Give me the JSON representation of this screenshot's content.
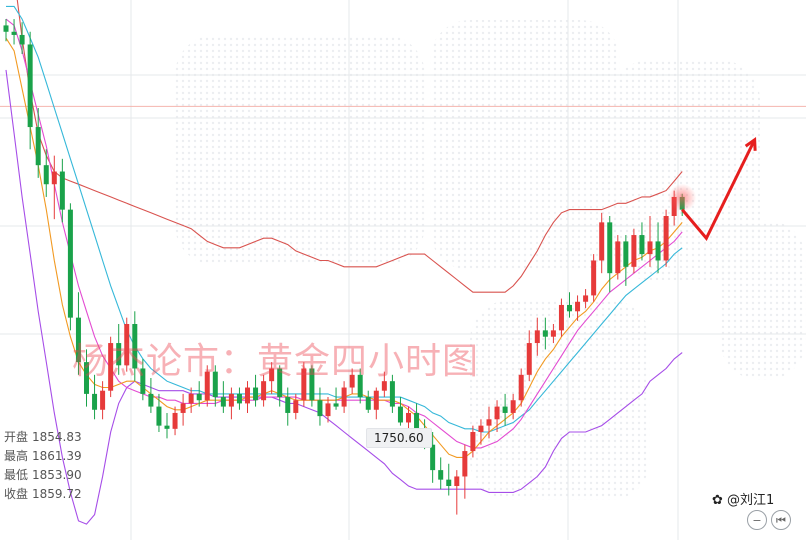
{
  "ohlc": {
    "open_label": "开盘",
    "open_value": "1854.83",
    "high_label": "最高",
    "high_value": "1861.39",
    "low_label": "最低",
    "low_value": "1853.90",
    "close_label": "收盘",
    "close_value": "1859.72"
  },
  "low_marker": "1750.60",
  "watermark": "杨杰论市：黄金四小时图",
  "author": "刘江1",
  "controls": {
    "zoom_out": "−",
    "reset": "⏮"
  },
  "colors": {
    "up": "#e63a3a",
    "down": "#1aa24a",
    "bollinger_upper": "#d9534f",
    "bollinger_lower": "#a64de8",
    "ma_orange": "#f29a22",
    "ma_magenta": "#e34bd2",
    "ma_cyan": "#36b8d9",
    "forecast": "#e61e1e",
    "price_line": "#f4b4ae"
  },
  "chart_data": {
    "type": "candlestick",
    "instrument": "XAU 4H",
    "y_range": [
      1722,
      1892
    ],
    "marked_low": 1750.6,
    "candles": [
      [
        1884,
        1886,
        1879,
        1882
      ],
      [
        1882,
        1886,
        1878,
        1881
      ],
      [
        1881,
        1885,
        1875,
        1878
      ],
      [
        1878,
        1882,
        1845,
        1852
      ],
      [
        1852,
        1858,
        1836,
        1840
      ],
      [
        1840,
        1845,
        1830,
        1834
      ],
      [
        1834,
        1843,
        1823,
        1838
      ],
      [
        1838,
        1842,
        1822,
        1826
      ],
      [
        1826,
        1828,
        1788,
        1792
      ],
      [
        1792,
        1800,
        1774,
        1778
      ],
      [
        1778,
        1782,
        1764,
        1768
      ],
      [
        1768,
        1774,
        1760,
        1763
      ],
      [
        1763,
        1772,
        1760,
        1769
      ],
      [
        1769,
        1786,
        1767,
        1784
      ],
      [
        1784,
        1790,
        1774,
        1777
      ],
      [
        1777,
        1792,
        1775,
        1790
      ],
      [
        1790,
        1794,
        1772,
        1776
      ],
      [
        1776,
        1779,
        1766,
        1768
      ],
      [
        1768,
        1773,
        1762,
        1764
      ],
      [
        1764,
        1768,
        1756,
        1758
      ],
      [
        1758,
        1762,
        1754,
        1757
      ],
      [
        1757,
        1764,
        1755,
        1762
      ],
      [
        1762,
        1768,
        1758,
        1765
      ],
      [
        1765,
        1770,
        1762,
        1768
      ],
      [
        1768,
        1772,
        1764,
        1766
      ],
      [
        1766,
        1777,
        1764,
        1775
      ],
      [
        1775,
        1777,
        1764,
        1767
      ],
      [
        1767,
        1772,
        1762,
        1764
      ],
      [
        1764,
        1770,
        1760,
        1768
      ],
      [
        1768,
        1770,
        1763,
        1765
      ],
      [
        1765,
        1772,
        1762,
        1770
      ],
      [
        1770,
        1774,
        1764,
        1766
      ],
      [
        1766,
        1774,
        1764,
        1772
      ],
      [
        1772,
        1778,
        1768,
        1776
      ],
      [
        1776,
        1777,
        1764,
        1767
      ],
      [
        1767,
        1770,
        1758,
        1762
      ],
      [
        1762,
        1768,
        1760,
        1766
      ],
      [
        1766,
        1778,
        1764,
        1776
      ],
      [
        1776,
        1777,
        1764,
        1766
      ],
      [
        1766,
        1770,
        1758,
        1761
      ],
      [
        1761,
        1767,
        1759,
        1765
      ],
      [
        1765,
        1770,
        1763,
        1764
      ],
      [
        1764,
        1772,
        1762,
        1770
      ],
      [
        1770,
        1776,
        1768,
        1774
      ],
      [
        1774,
        1776,
        1765,
        1767
      ],
      [
        1767,
        1769,
        1762,
        1763
      ],
      [
        1763,
        1770,
        1760,
        1769
      ],
      [
        1769,
        1775,
        1767,
        1772
      ],
      [
        1772,
        1774,
        1762,
        1764
      ],
      [
        1764,
        1767,
        1758,
        1759
      ],
      [
        1759,
        1764,
        1757,
        1762
      ],
      [
        1762,
        1765,
        1755,
        1757
      ],
      [
        1757,
        1760,
        1750.6,
        1752
      ],
      [
        1752,
        1756,
        1740,
        1744
      ],
      [
        1744,
        1748,
        1738,
        1741
      ],
      [
        1741,
        1746,
        1736,
        1739
      ],
      [
        1739,
        1744,
        1730,
        1742
      ],
      [
        1742,
        1752,
        1735,
        1750
      ],
      [
        1750,
        1758,
        1748,
        1756
      ],
      [
        1756,
        1760,
        1752,
        1758
      ],
      [
        1758,
        1764,
        1754,
        1760
      ],
      [
        1760,
        1766,
        1756,
        1764
      ],
      [
        1764,
        1768,
        1758,
        1762
      ],
      [
        1762,
        1768,
        1760,
        1766
      ],
      [
        1766,
        1776,
        1764,
        1774
      ],
      [
        1774,
        1788,
        1772,
        1784
      ],
      [
        1784,
        1792,
        1780,
        1788
      ],
      [
        1788,
        1792,
        1782,
        1786
      ],
      [
        1786,
        1790,
        1784,
        1788
      ],
      [
        1788,
        1798,
        1786,
        1796
      ],
      [
        1796,
        1800,
        1792,
        1794
      ],
      [
        1794,
        1799,
        1791,
        1797
      ],
      [
        1797,
        1801,
        1795,
        1799
      ],
      [
        1799,
        1812,
        1797,
        1810
      ],
      [
        1810,
        1825,
        1806,
        1822
      ],
      [
        1822,
        1824,
        1800,
        1806
      ],
      [
        1806,
        1818,
        1804,
        1816
      ],
      [
        1816,
        1818,
        1802,
        1808
      ],
      [
        1808,
        1820,
        1806,
        1818
      ],
      [
        1818,
        1822,
        1810,
        1812
      ],
      [
        1812,
        1824,
        1808,
        1816
      ],
      [
        1816,
        1822,
        1806,
        1810
      ],
      [
        1810,
        1826,
        1808,
        1824
      ],
      [
        1824,
        1832,
        1821,
        1830
      ],
      [
        1830,
        1831,
        1824,
        1826
      ]
    ],
    "bollinger_upper": [
      1924,
      1900,
      1880,
      1863,
      1850,
      1843,
      1838,
      1836,
      1835,
      1834,
      1833,
      1832,
      1831,
      1830,
      1829,
      1828,
      1827,
      1826,
      1825,
      1824,
      1823,
      1822,
      1821,
      1820,
      1818,
      1816,
      1815,
      1814,
      1814,
      1814,
      1815,
      1816,
      1817,
      1817,
      1816,
      1815,
      1813,
      1812,
      1811,
      1810,
      1810,
      1809,
      1808,
      1808,
      1808,
      1808,
      1808,
      1809,
      1810,
      1811,
      1812,
      1812,
      1812,
      1810,
      1808,
      1806,
      1804,
      1802,
      1800,
      1800,
      1800,
      1800,
      1800,
      1802,
      1805,
      1809,
      1813,
      1818,
      1822,
      1825,
      1826,
      1826,
      1826,
      1826,
      1826,
      1827,
      1828,
      1828,
      1829,
      1830,
      1830,
      1831,
      1832,
      1835,
      1838
    ],
    "bollinger_lower": [
      1870,
      1850,
      1830,
      1812,
      1794,
      1778,
      1762,
      1748,
      1737,
      1728,
      1727,
      1730,
      1742,
      1756,
      1765,
      1770,
      1772,
      1771,
      1770,
      1769,
      1769,
      1769,
      1769,
      1768,
      1768,
      1768,
      1767,
      1767,
      1767,
      1767,
      1767,
      1767,
      1767,
      1767,
      1766,
      1765,
      1765,
      1764,
      1763,
      1762,
      1760,
      1758,
      1756,
      1754,
      1752,
      1750,
      1748,
      1746,
      1743,
      1741,
      1739,
      1738,
      1738,
      1738,
      1738,
      1738,
      1738,
      1738,
      1738,
      1738,
      1737,
      1737,
      1737,
      1737,
      1738,
      1740,
      1742,
      1745,
      1750,
      1754,
      1756,
      1756,
      1756,
      1757,
      1758,
      1760,
      1762,
      1764,
      1766,
      1768,
      1772,
      1774,
      1776,
      1779,
      1781
    ],
    "ma_orange": [
      1880,
      1876,
      1864,
      1852,
      1840,
      1826,
      1810,
      1796,
      1786,
      1778,
      1774,
      1771,
      1770,
      1770,
      1771,
      1772,
      1772,
      1770,
      1768,
      1766,
      1764,
      1763,
      1763,
      1764,
      1765,
      1766,
      1766,
      1766,
      1766,
      1766,
      1767,
      1767,
      1768,
      1769,
      1768,
      1767,
      1766,
      1766,
      1766,
      1766,
      1766,
      1766,
      1767,
      1768,
      1768,
      1767,
      1766,
      1766,
      1766,
      1765,
      1763,
      1761,
      1758,
      1755,
      1752,
      1749,
      1748,
      1748,
      1750,
      1753,
      1756,
      1758,
      1760,
      1762,
      1765,
      1770,
      1775,
      1779,
      1782,
      1786,
      1789,
      1792,
      1794,
      1797,
      1801,
      1804,
      1806,
      1808,
      1810,
      1811,
      1813,
      1814,
      1816,
      1819,
      1822
    ],
    "ma_magenta": [
      1886,
      1884,
      1876,
      1866,
      1856,
      1846,
      1834,
      1822,
      1812,
      1802,
      1794,
      1786,
      1780,
      1776,
      1772,
      1770,
      1769,
      1768,
      1767,
      1767,
      1766,
      1766,
      1765,
      1765,
      1765,
      1765,
      1765,
      1766,
      1766,
      1766,
      1766,
      1766,
      1767,
      1767,
      1767,
      1767,
      1767,
      1766,
      1766,
      1766,
      1766,
      1766,
      1766,
      1766,
      1766,
      1766,
      1766,
      1766,
      1765,
      1765,
      1764,
      1762,
      1761,
      1759,
      1757,
      1755,
      1753,
      1752,
      1751,
      1751,
      1752,
      1753,
      1755,
      1757,
      1760,
      1764,
      1768,
      1772,
      1776,
      1780,
      1784,
      1788,
      1791,
      1794,
      1797,
      1800,
      1802,
      1804,
      1806,
      1808,
      1810,
      1812,
      1814,
      1816,
      1819
    ],
    "ma_cyan": [
      1890,
      1890,
      1886,
      1880,
      1874,
      1866,
      1858,
      1850,
      1842,
      1834,
      1826,
      1818,
      1810,
      1802,
      1795,
      1788,
      1783,
      1779,
      1776,
      1774,
      1772,
      1771,
      1770,
      1769,
      1769,
      1768,
      1768,
      1768,
      1768,
      1768,
      1768,
      1768,
      1768,
      1768,
      1768,
      1768,
      1768,
      1768,
      1768,
      1768,
      1768,
      1767,
      1767,
      1767,
      1767,
      1767,
      1767,
      1767,
      1767,
      1767,
      1766,
      1765,
      1764,
      1762,
      1761,
      1759,
      1758,
      1757,
      1757,
      1756,
      1756,
      1757,
      1758,
      1759,
      1761,
      1763,
      1766,
      1769,
      1772,
      1775,
      1778,
      1781,
      1784,
      1787,
      1790,
      1793,
      1796,
      1799,
      1801,
      1803,
      1805,
      1807,
      1809,
      1812,
      1814
    ],
    "current_price": 1858.5,
    "forecast_path": [
      [
        84,
        1826
      ],
      [
        87,
        1817
      ],
      [
        93,
        1848
      ]
    ]
  }
}
